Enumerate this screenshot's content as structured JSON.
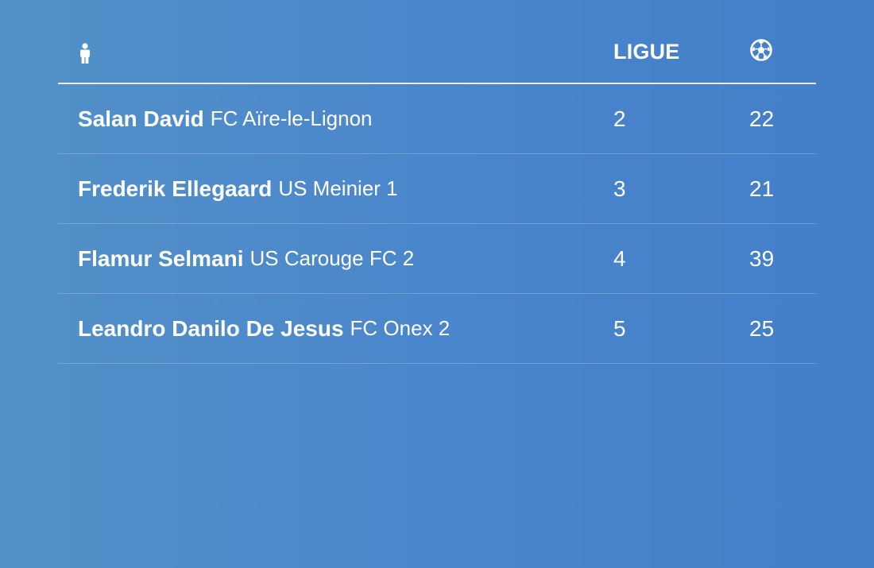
{
  "header": {
    "player_icon": "person-icon",
    "league_label": "LIGUE",
    "goals_icon": "soccer-ball-icon"
  },
  "rows": [
    {
      "player": "Salan David",
      "club": "FC Aïre-le-Lignon",
      "league": "2",
      "goals": "22"
    },
    {
      "player": "Frederik Ellegaard",
      "club": "US Meinier 1",
      "league": "3",
      "goals": "21"
    },
    {
      "player": "Flamur Selmani",
      "club": "US Carouge FC 2",
      "league": "4",
      "goals": "39"
    },
    {
      "player": "Leandro Danilo De Jesus",
      "club": "FC Onex 2",
      "league": "5",
      "goals": "25"
    }
  ]
}
